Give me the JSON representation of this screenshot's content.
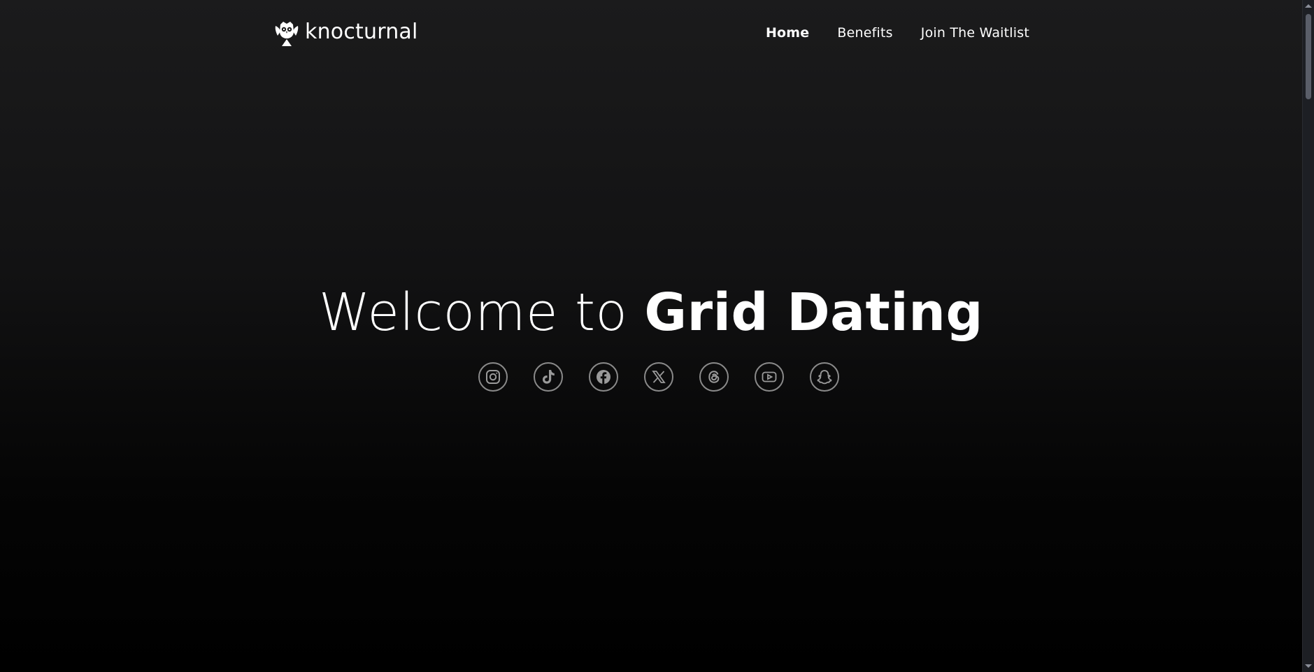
{
  "brand": {
    "name": "knocturnal"
  },
  "nav": {
    "items": [
      {
        "label": "Home",
        "active": true
      },
      {
        "label": "Benefits",
        "active": false
      },
      {
        "label": "Join The Waitlist",
        "active": false
      }
    ]
  },
  "hero": {
    "title_light": "Welcome to ",
    "title_bold": "Grid Dating"
  },
  "socials": {
    "items": [
      {
        "icon": "instagram-icon"
      },
      {
        "icon": "tiktok-icon"
      },
      {
        "icon": "facebook-icon"
      },
      {
        "icon": "x-icon"
      },
      {
        "icon": "threads-icon"
      },
      {
        "icon": "youtube-icon"
      },
      {
        "icon": "snapchat-icon"
      }
    ],
    "color": "#9a9a9a"
  },
  "colors": {
    "background_top": "#1b1b1c",
    "background_bottom": "#000000",
    "text": "#ffffff"
  }
}
